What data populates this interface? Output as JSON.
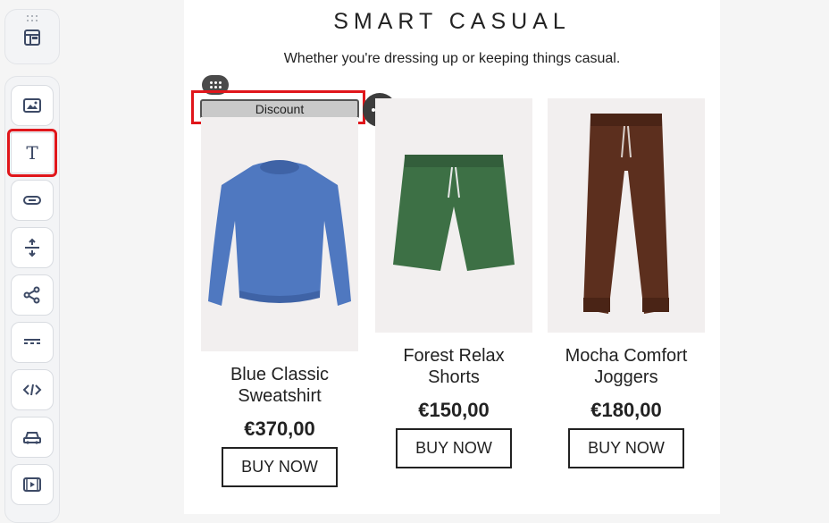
{
  "toolbar": {
    "top_icon": "layout-icon",
    "items": [
      {
        "name": "image",
        "icon": "image-icon"
      },
      {
        "name": "text",
        "icon": "text-icon",
        "glyph": "T",
        "active": true
      },
      {
        "name": "button",
        "icon": "button-icon"
      },
      {
        "name": "spacer",
        "icon": "spacer-icon"
      },
      {
        "name": "social",
        "icon": "share-icon"
      },
      {
        "name": "divider",
        "icon": "divider-icon"
      },
      {
        "name": "html",
        "icon": "code-icon"
      },
      {
        "name": "product",
        "icon": "car-icon"
      },
      {
        "name": "video",
        "icon": "video-icon"
      }
    ]
  },
  "header": {
    "title": "SMART CASUAL",
    "subtitle": "Whether you're dressing up or keeping things casual."
  },
  "selection": {
    "discount_label": "Discount",
    "accent": "#e0161b"
  },
  "products": [
    {
      "name_line1": "Blue Classic",
      "name_line2": "Sweatshirt",
      "price": "€370,00",
      "button": "BUY NOW",
      "color": "#4f78c0"
    },
    {
      "name_line1": "Forest Relax",
      "name_line2": "Shorts",
      "price": "€150,00",
      "button": "BUY NOW",
      "color": "#3d7045"
    },
    {
      "name_line1": "Mocha Comfort",
      "name_line2": "Joggers",
      "price": "€180,00",
      "button": "BUY NOW",
      "color": "#5c2f1e"
    }
  ]
}
